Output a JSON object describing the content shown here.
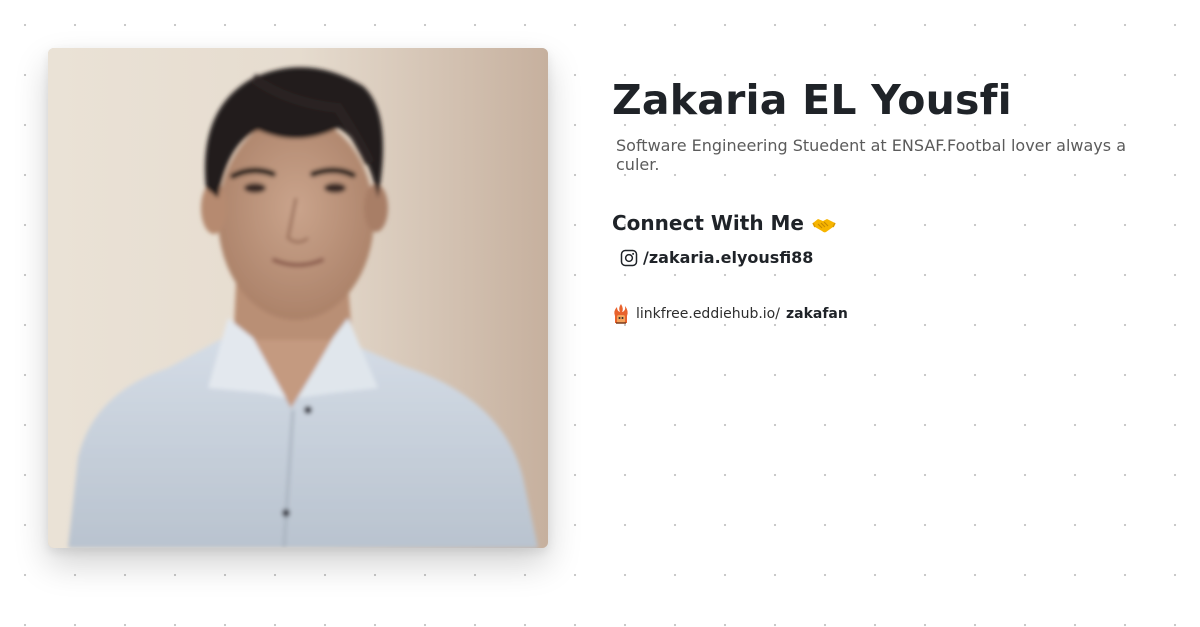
{
  "profile": {
    "name": "Zakaria EL Yousfi",
    "bio": "Software Engineering Stuedent at ENSAF.Footbal lover always a culer.",
    "photo_icon": "profile-photo"
  },
  "connect": {
    "heading": "Connect With Me",
    "heading_icon": "handshake-icon",
    "links": [
      {
        "icon": "instagram-icon",
        "label": "/zakaria.elyousfi88"
      }
    ]
  },
  "footer": {
    "prefix": "linkfree.eddiehub.io/",
    "username": "zakafan",
    "icon": "linkfree-logo-icon"
  },
  "colors": {
    "text": "#1f2328",
    "muted": "#5b5b5b",
    "background": "#ffffff",
    "dots": "#c6c6c6",
    "handshake": "#f7b500"
  }
}
